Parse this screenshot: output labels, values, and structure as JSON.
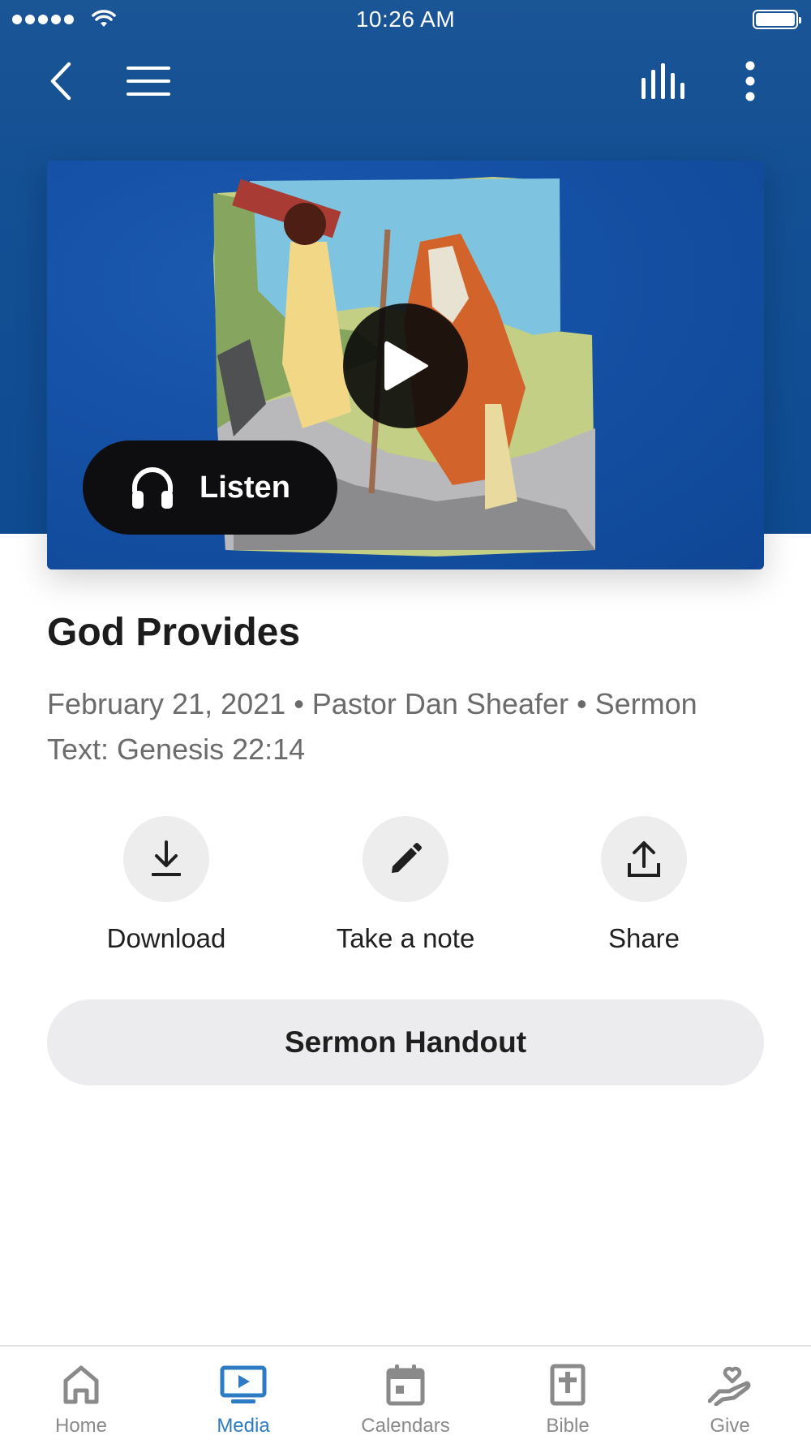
{
  "status_bar": {
    "time": "10:26 AM"
  },
  "header": {
    "back_icon": "chevron-left-icon",
    "menu_icon": "hamburger-icon",
    "audio_icon": "audio-bars-icon",
    "more_icon": "vertical-dots-icon"
  },
  "media": {
    "listen_label": "Listen",
    "artwork": "illustration of Abraham and Isaac climbing a mountain with firewood"
  },
  "sermon": {
    "title": "God Provides",
    "meta_line1": "February 21, 2021 • Pastor Dan Sheafer • Sermon",
    "meta_line2": "Text: Genesis 22:14"
  },
  "actions": [
    {
      "label": "Download",
      "icon": "download-icon"
    },
    {
      "label": "Take a note",
      "icon": "pencil-icon"
    },
    {
      "label": "Share",
      "icon": "share-icon"
    }
  ],
  "handout_label": "Sermon Handout",
  "tabs": [
    {
      "label": "Home",
      "icon": "home-icon"
    },
    {
      "label": "Media",
      "icon": "media-icon",
      "active": true
    },
    {
      "label": "Calendars",
      "icon": "calendar-icon"
    },
    {
      "label": "Bible",
      "icon": "bible-icon"
    },
    {
      "label": "Give",
      "icon": "give-icon"
    }
  ],
  "colors": {
    "header_blue": "#134f93",
    "active_tab": "#2d7bc4",
    "inactive_tab": "#8a8a8a"
  }
}
